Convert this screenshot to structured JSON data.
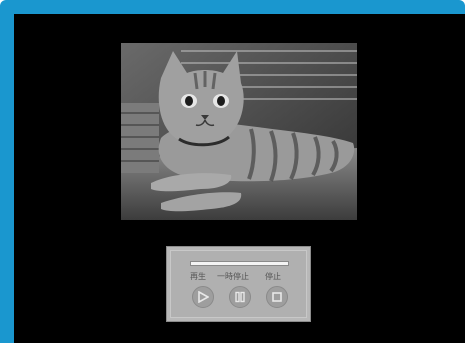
{
  "player": {
    "progress_fraction": 0,
    "buttons": [
      {
        "label": "再生",
        "icon": "play-icon"
      },
      {
        "label": "一時停止",
        "icon": "pause-icon"
      },
      {
        "label": "停止",
        "icon": "stop-icon"
      }
    ]
  },
  "colors": {
    "frame": "#1a97cf",
    "screen": "#000000",
    "panel": "#b8b8b8",
    "button": "#9e9e9e",
    "icon": "#e8e8e8"
  }
}
